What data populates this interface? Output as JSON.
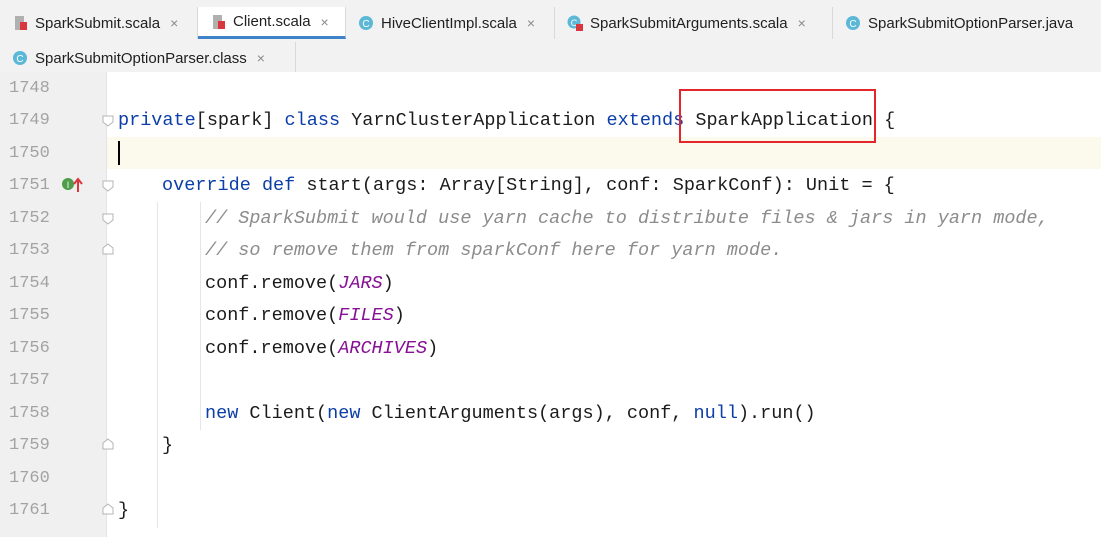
{
  "tabs_row1": [
    {
      "label": "SparkSubmit.scala",
      "icon": "scala-file-icon",
      "active": false
    },
    {
      "label": "Client.scala",
      "icon": "scala-file-icon",
      "active": true
    },
    {
      "label": "HiveClientImpl.scala",
      "icon": "scala-class-icon",
      "active": false
    },
    {
      "label": "SparkSubmitArguments.scala",
      "icon": "scala-class-icon",
      "active": false
    },
    {
      "label": "SparkSubmitOptionParser.java",
      "icon": "java-class-icon",
      "active": false
    }
  ],
  "tabs_row2": [
    {
      "label": "SparkSubmitOptionParser.class",
      "icon": "class-file-icon",
      "active": false
    }
  ],
  "close_glyph": "×",
  "line_numbers": [
    "1748",
    "1749",
    "1750",
    "1751",
    "1752",
    "1753",
    "1754",
    "1755",
    "1756",
    "1757",
    "1758",
    "1759",
    "1760",
    "1761"
  ],
  "code": {
    "l1749": {
      "kw1": "private",
      "p1": "[spark] ",
      "kw2": "class",
      "p2": " YarnClusterApplication ",
      "kw3": "extends",
      "p3": " SparkApplication {"
    },
    "l1751": {
      "kw1": "override",
      "p1": " ",
      "kw2": "def",
      "p2": " start(args: Array[String], conf: SparkConf): Unit = {"
    },
    "l1752": "// SparkSubmit would use yarn cache to distribute files & jars in yarn mode,",
    "l1753": "// so remove them from sparkConf here for yarn mode.",
    "l1754": {
      "p1": "conf.remove(",
      "c": "JARS",
      "p2": ")"
    },
    "l1755": {
      "p1": "conf.remove(",
      "c": "FILES",
      "p2": ")"
    },
    "l1756": {
      "p1": "conf.remove(",
      "c": "ARCHIVES",
      "p2": ")"
    },
    "l1758": {
      "kw1": "new",
      "p1": " Client(",
      "kw2": "new",
      "p2": " ClientArguments(args), conf, ",
      "kw3": "null",
      "p3": ").run()"
    },
    "l1759": "}",
    "l1761": "}"
  },
  "colors": {
    "keyword": "#0b3ea8",
    "comment": "#8c8c8c",
    "constant": "#871094",
    "highlight_box": "#e3262c",
    "active_tab_underline": "#4083c9"
  }
}
